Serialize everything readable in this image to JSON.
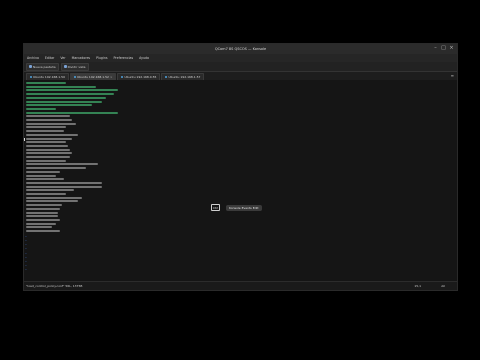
{
  "window": {
    "title": "QCom7 8S QSCOS — Konsole",
    "controls": [
      "–",
      "□",
      "×"
    ]
  },
  "menubar": {
    "items": [
      "Archivo",
      "Editar",
      "Ver",
      "Marcadores",
      "Plugins",
      "Preferencias",
      "Ayuda"
    ]
  },
  "toolbar": {
    "buttons": [
      {
        "label": "Nueva pestaña"
      },
      {
        "label": "Dividir vista"
      }
    ]
  },
  "tabs": [
    {
      "label": "Ubuntu 192.168.1.50",
      "active": false
    },
    {
      "label": "Ubuntu 192.168.1.52",
      "active": true
    },
    {
      "label": "Ubuntu 192.168.0.55",
      "active": false
    },
    {
      "label": "Ubuntu 192.168.1.57",
      "active": false
    }
  ],
  "tab_menu_icon": "hamburger-menu-icon",
  "accent": "#4fa3e0",
  "status": {
    "file_info": "\"load_control_policy.conf\" 56L, 1375B",
    "position": "15,1",
    "percent": "All"
  },
  "popup": {
    "key": "Ctrl",
    "text": "Konsole Events Edit"
  }
}
